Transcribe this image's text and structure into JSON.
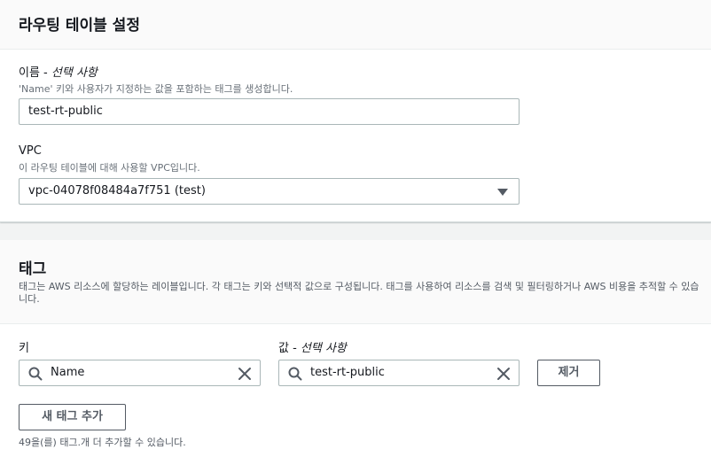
{
  "routing": {
    "title": "라우팅 테이블 설정",
    "name_label": "이름 - ",
    "name_optional": "선택 사항",
    "name_desc": "'Name' 키와 사용자가 지정하는 값을 포함하는 태그를 생성합니다.",
    "name_value": "test-rt-public",
    "vpc_label": "VPC",
    "vpc_desc": "이 라우팅 테이블에 대해 사용할 VPC입니다.",
    "vpc_value": "vpc-04078f08484a7f751 (test)"
  },
  "tags": {
    "title": "태그",
    "desc": "태그는 AWS 리소스에 할당하는 레이블입니다. 각 태그는 키와 선택적 값으로 구성됩니다. 태그를 사용하여 리소스를 검색 및 필터링하거나 AWS 비용을 추적할 수 있습니다.",
    "key_label": "키",
    "value_label": "값 - ",
    "value_optional": "선택 사항",
    "items": [
      {
        "key": "Name",
        "value": "test-rt-public"
      }
    ],
    "remove_label": "제거",
    "add_label": "새 태그 추가",
    "remaining_hint": "49을(를) 태그.개 더 추가할 수 있습니다."
  },
  "icons": {
    "search": "search-icon",
    "clear": "close-icon",
    "dropdown": "caret-down-icon"
  }
}
